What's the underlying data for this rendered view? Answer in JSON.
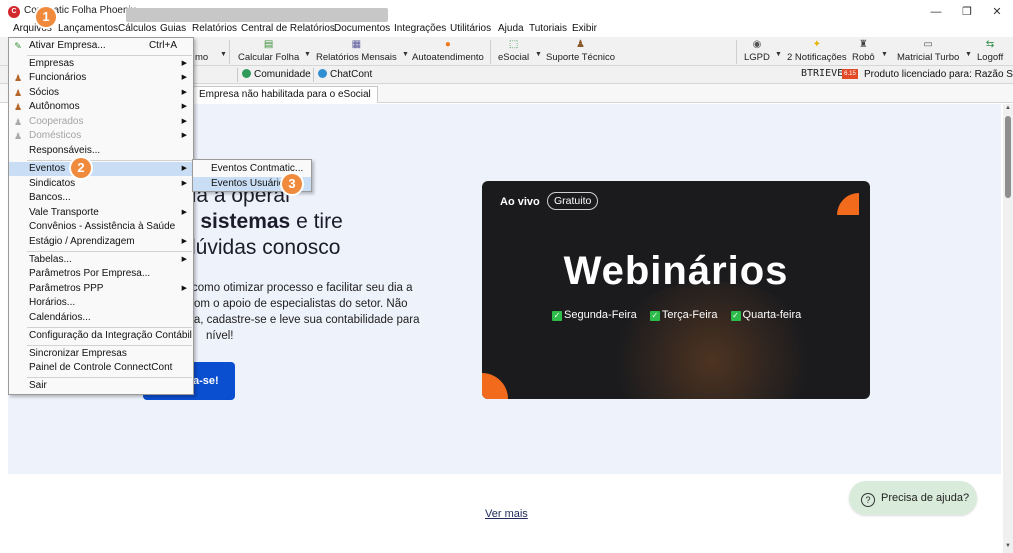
{
  "window": {
    "app_icon_letter": "C",
    "title": "Contmatic Folha Phoenix",
    "minimize": "—",
    "restore": "❐",
    "close": "✕"
  },
  "menubar": [
    "Arquivos",
    "Lançamentos",
    "Cálculos",
    "Guias",
    "Relatórios",
    "Central de Relatórios",
    "Documentos",
    "Integrações",
    "Utilitários",
    "Ajuda",
    "Tutoriais",
    "Exibir"
  ],
  "toolbar": {
    "buttons": [
      {
        "label": "mo",
        "icon": "cut-off-icon"
      },
      {
        "label": "Calcular Folha",
        "icon": "calculator-icon"
      },
      {
        "label": "Relatórios Mensais",
        "icon": "report-icon"
      },
      {
        "label": "Autoatendimento",
        "icon": "help-circle-icon"
      },
      {
        "label": "eSocial",
        "icon": "esocial-icon"
      },
      {
        "label": "Suporte Técnico",
        "icon": "support-icon"
      },
      {
        "label": "LGPD",
        "icon": "eye-icon"
      },
      {
        "label": "2 Notificações",
        "icon": "bell-icon"
      },
      {
        "label": "Robô",
        "icon": "robot-icon"
      },
      {
        "label": "Matricial Turbo",
        "icon": "printer-icon"
      },
      {
        "label": "Logoff",
        "icon": "logoff-icon"
      }
    ]
  },
  "toolbar2": {
    "comunidade": "Comunidade",
    "chatcont": "ChatCont",
    "btrieve": "BTRIEVE",
    "btrieve_badge": "6.15",
    "licensed": "Produto licenciado para:  Razão Socia"
  },
  "tabs": {
    "active": "Empresa não habilitada para o eSocial"
  },
  "content": {
    "hero_line1": "ida a operar",
    "hero_line2_bold": "os sistemas",
    "hero_line2_rest": " e tire",
    "hero_line3": "dúvidas conosco",
    "hero_desc": "como otimizar processo e facilitar seu dia a dia com o apoio de especialistas do setor. Não perca, cadastre-se e leve sua contabilidade para o nível!",
    "hero_desc_lines": [
      "como otimizar processo e facilitar seu dia a",
      "om o apoio de especialistas do setor. Não",
      "ra, cadastre-se e leve sua contabilidade para",
      "nível!"
    ],
    "cta": "a-se!",
    "webinar": {
      "live": "Ao vivo",
      "badge": "Gratuito",
      "title": "Webinários",
      "days": [
        "Segunda-Feira",
        "Terça-Feira",
        "Quarta-feira"
      ]
    },
    "ver_mais": "Ver mais",
    "help": "Precisa de ajuda?"
  },
  "menu_arquivos": {
    "items": [
      {
        "label": "Ativar Empresa...",
        "shortcut": "Ctrl+A",
        "icon": "activate-icon"
      },
      {
        "label": "Empresas",
        "submenu": true
      },
      {
        "label": "Funcionários",
        "submenu": true,
        "icon": "person-icon"
      },
      {
        "label": "Sócios",
        "submenu": true,
        "icon": "person-icon"
      },
      {
        "label": "Autônomos",
        "submenu": true,
        "icon": "person-icon"
      },
      {
        "label": "Cooperados",
        "submenu": true,
        "icon": "person-icon",
        "disabled": true
      },
      {
        "label": "Domésticos",
        "submenu": true,
        "icon": "person-icon",
        "disabled": true
      },
      {
        "label": "Responsáveis..."
      },
      {
        "label": "Eventos",
        "submenu": true,
        "highlighted": true
      },
      {
        "label": "Sindicatos",
        "submenu": true
      },
      {
        "label": "Bancos..."
      },
      {
        "label": "Vale Transporte",
        "submenu": true
      },
      {
        "label": "Convênios - Assistência à Saúde"
      },
      {
        "label": "Estágio / Aprendizagem",
        "submenu": true
      },
      {
        "label": "Tabelas...",
        "submenu": true
      },
      {
        "label": "Parâmetros Por Empresa..."
      },
      {
        "label": "Parâmetros PPP",
        "submenu": true
      },
      {
        "label": "Horários..."
      },
      {
        "label": "Calendários..."
      },
      {
        "label": "Configuração da Integração Contábil"
      },
      {
        "label": "Sincronizar Empresas"
      },
      {
        "label": "Painel de Controle ConnectCont"
      },
      {
        "label": "Sair"
      }
    ]
  },
  "menu_eventos": {
    "items": [
      {
        "label": "Eventos Contmatic..."
      },
      {
        "label": "Eventos Usuário...",
        "highlighted": true
      }
    ]
  },
  "steps": [
    "1",
    "2",
    "3"
  ],
  "colors": {
    "accent_orange": "#f08a3c",
    "menu_highlight": "#c9def5",
    "cta_blue": "#0b4fd1",
    "webinar_bg": "#1b1b1e"
  }
}
